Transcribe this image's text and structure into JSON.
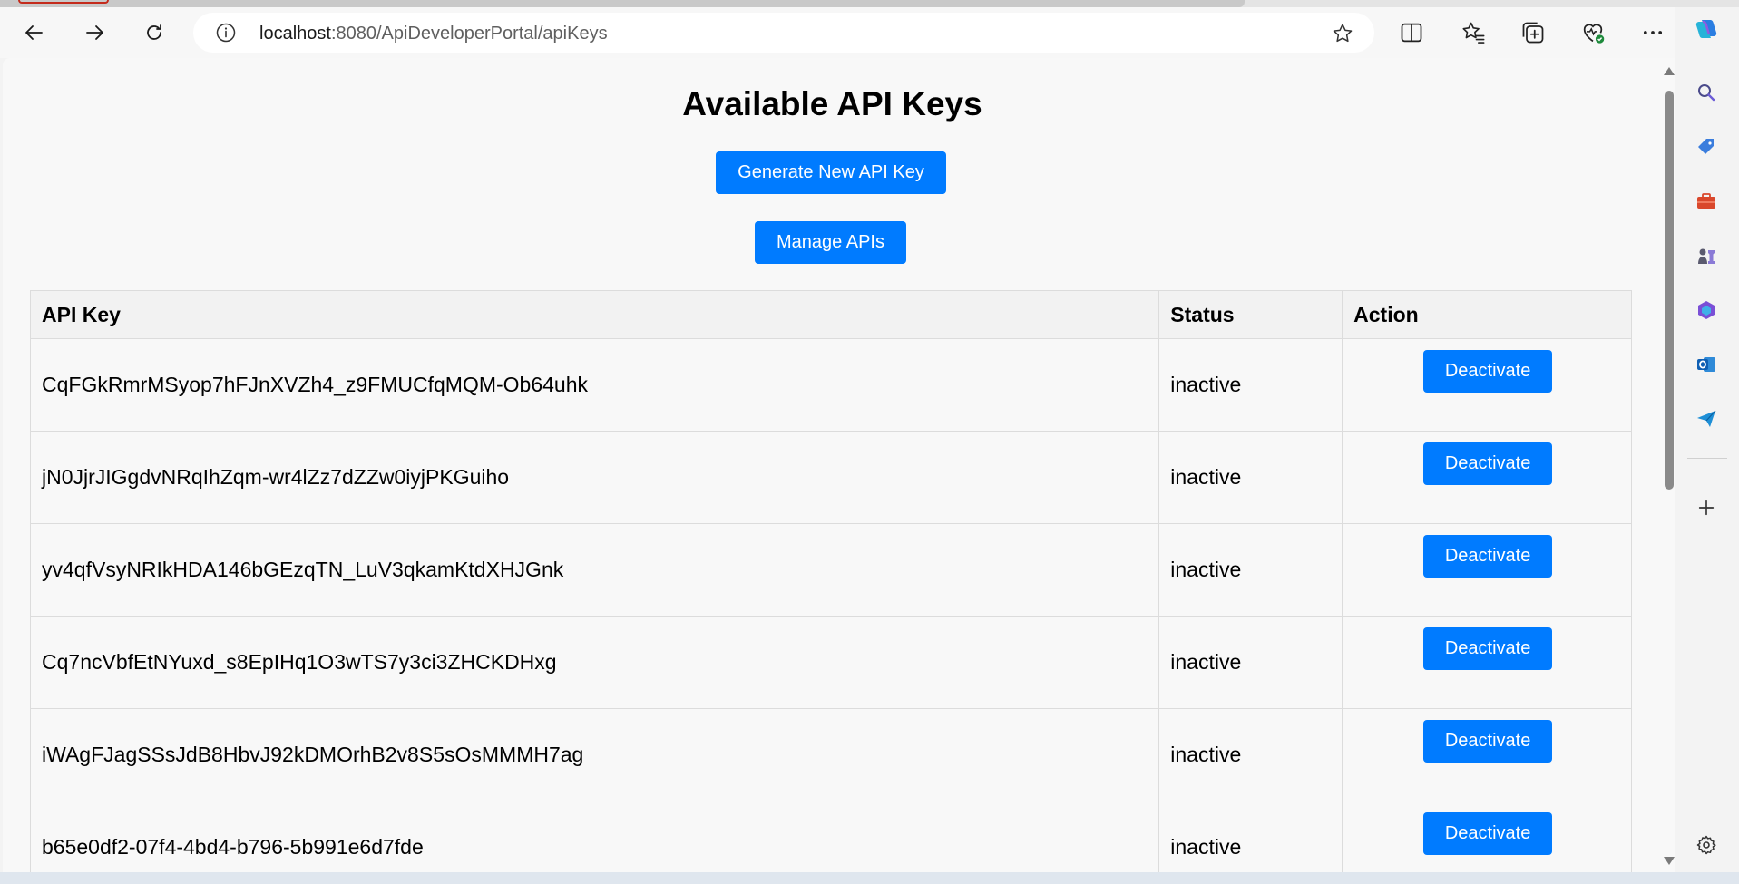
{
  "browser": {
    "url_host": "localhost",
    "url_path": ":8080/ApiDeveloperPortal/apiKeys"
  },
  "page": {
    "title": "Available API Keys",
    "generate_label": "Generate New API Key",
    "manage_label": "Manage APIs"
  },
  "table": {
    "headers": [
      "API Key",
      "Status",
      "Action"
    ],
    "rows": [
      {
        "key": "CqFGkRmrMSyop7hFJnXVZh4_z9FMUCfqMQM-Ob64uhk",
        "status": "inactive",
        "action": "Deactivate"
      },
      {
        "key": "jN0JjrJIGgdvNRqIhZqm-wr4lZz7dZZw0iyjPKGuiho",
        "status": "inactive",
        "action": "Deactivate"
      },
      {
        "key": "yv4qfVsyNRIkHDA146bGEzqTN_LuV3qkamKtdXHJGnk",
        "status": "inactive",
        "action": "Deactivate"
      },
      {
        "key": "Cq7ncVbfEtNYuxd_s8EpIHq1O3wTS7y3ci3ZHCKDHxg",
        "status": "inactive",
        "action": "Deactivate"
      },
      {
        "key": "iWAgFJagSSsJdB8HbvJ92kDMOrhB2v8S5sOsMMMH7ag",
        "status": "inactive",
        "action": "Deactivate"
      },
      {
        "key": "b65e0df2-07f4-4bd4-b796-5b991e6d7fde",
        "status": "inactive",
        "action": "Deactivate"
      }
    ]
  },
  "colors": {
    "primary_button": "#007bff"
  }
}
